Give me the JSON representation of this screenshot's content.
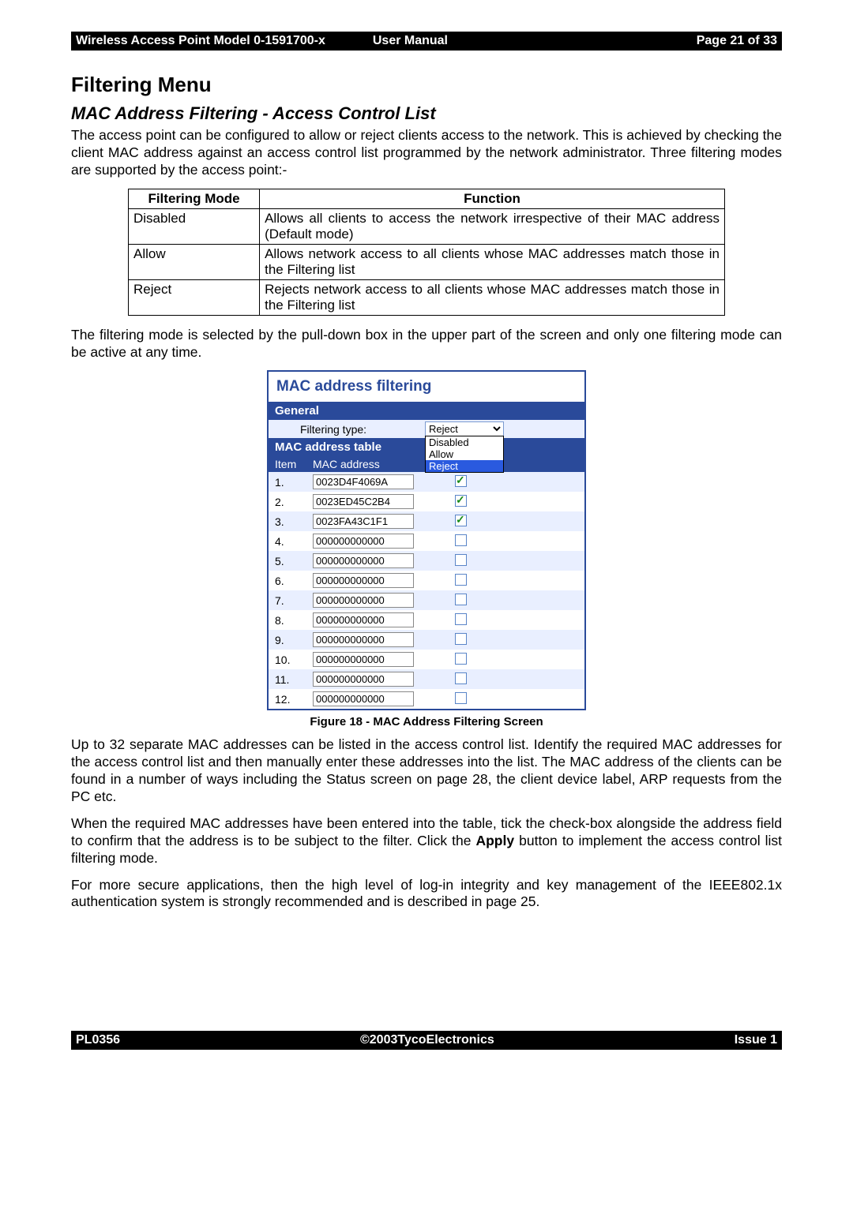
{
  "header": {
    "left": "Wireless Access Point  Model 0-1591700-x",
    "mid": "User Manual",
    "right": "Page 21 of 33"
  },
  "section_title": "Filtering Menu",
  "subsection_title": "MAC Address Filtering - Access Control List",
  "para1": "The access point can be configured to allow or reject clients access to the network. This is achieved by checking the client MAC address against an access control list programmed by the network administrator. Three filtering modes are supported by the access point:-",
  "modes_table": {
    "headers": [
      "Filtering Mode",
      "Function"
    ],
    "rows": [
      [
        "Disabled",
        "Allows all clients to access the network irrespective of their MAC address (Default mode)"
      ],
      [
        "Allow",
        "Allows network access to all clients whose MAC addresses match those in the Filtering list"
      ],
      [
        "Reject",
        "Rejects network access to all clients whose MAC addresses match those in the Filtering list"
      ]
    ]
  },
  "para2": "The filtering mode is selected by the pull-down box in the upper part of the screen and only one filtering mode can be active at any time.",
  "ui": {
    "panel_title": "MAC address filtering",
    "general_label": "General",
    "filtering_label": "Filtering type:",
    "filtering_selected": "Reject",
    "filtering_options": [
      "Disabled",
      "Allow",
      "Reject"
    ],
    "mac_table_label": "MAC address table",
    "col_item": "Item",
    "col_mac": "MAC address",
    "rows": [
      {
        "n": "1.",
        "mac": "0023D4F4069A",
        "checked": true
      },
      {
        "n": "2.",
        "mac": "0023ED45C2B4",
        "checked": true
      },
      {
        "n": "3.",
        "mac": "0023FA43C1F1",
        "checked": true
      },
      {
        "n": "4.",
        "mac": "000000000000",
        "checked": false
      },
      {
        "n": "5.",
        "mac": "000000000000",
        "checked": false
      },
      {
        "n": "6.",
        "mac": "000000000000",
        "checked": false
      },
      {
        "n": "7.",
        "mac": "000000000000",
        "checked": false
      },
      {
        "n": "8.",
        "mac": "000000000000",
        "checked": false
      },
      {
        "n": "9.",
        "mac": "000000000000",
        "checked": false
      },
      {
        "n": "10.",
        "mac": "000000000000",
        "checked": false
      },
      {
        "n": "11.",
        "mac": "000000000000",
        "checked": false
      },
      {
        "n": "12.",
        "mac": "000000000000",
        "checked": false
      }
    ]
  },
  "figure_caption": "Figure 18 - MAC Address Filtering Screen",
  "para3a": "Up to 32 separate MAC addresses can be listed in the access control list. Identify the required MAC addresses for the access control list and then manually enter these addresses into the list. The MAC address of the clients can be found in a number of ways including the Status screen on page 28, the client device label, ARP requests from the PC etc.",
  "para3b_pre": "When the required MAC addresses have been entered into the table, tick the check-box alongside the address field to confirm that the address is to be subject to the filter. Click the ",
  "para3b_bold": "Apply",
  "para3b_post": " button to implement the access control list filtering mode.",
  "para3c": "For more secure applications, then the high level of log-in integrity and key management of the IEEE802.1x authentication system is strongly recommended and is described in page 25.",
  "footer": {
    "left": "PL0356",
    "mid": "©2003TycoElectronics",
    "right": "Issue 1"
  }
}
